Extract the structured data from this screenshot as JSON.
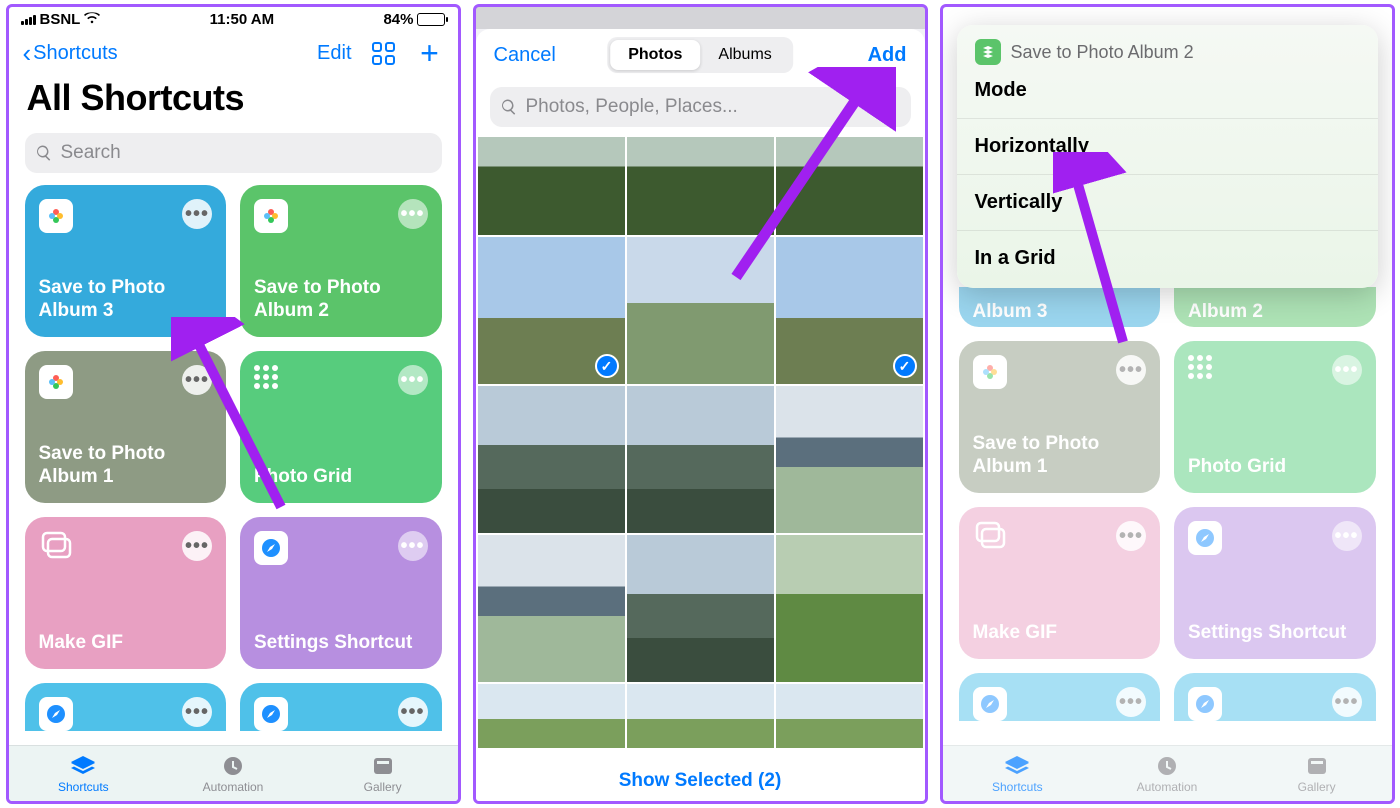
{
  "screen1": {
    "status": {
      "carrier": "BSNL",
      "time": "11:50 AM",
      "battery_pct": "84%"
    },
    "nav": {
      "back": "Shortcuts",
      "edit": "Edit"
    },
    "title": "All Shortcuts",
    "search_placeholder": "Search",
    "tiles": [
      {
        "label": "Save to Photo Album 3",
        "color": "c-blue",
        "icon": "photos"
      },
      {
        "label": "Save to Photo Album 2",
        "color": "c-green",
        "icon": "photos"
      },
      {
        "label": "Save to Photo Album 1",
        "color": "c-olive",
        "icon": "photos"
      },
      {
        "label": "Photo Grid",
        "color": "c-mint",
        "icon": "keypad"
      },
      {
        "label": "Make GIF",
        "color": "c-pink",
        "icon": "stack"
      },
      {
        "label": "Settings Shortcut",
        "color": "c-purple",
        "icon": "safari"
      }
    ],
    "tab_labels": {
      "shortcuts": "Shortcuts",
      "automation": "Automation",
      "gallery": "Gallery"
    }
  },
  "screen2": {
    "cancel": "Cancel",
    "add": "Add",
    "segments": {
      "photos": "Photos",
      "albums": "Albums"
    },
    "search_placeholder": "Photos, People, Places...",
    "footer": "Show Selected (2)"
  },
  "screen3": {
    "popup_title": "Save to Photo Album 2",
    "options": [
      "Mode",
      "Horizontally",
      "Vertically",
      "In a Grid"
    ],
    "bg_tiles": {
      "album3": "Album 3",
      "album2": "Album 2",
      "album1": "Save to Photo Album 1",
      "grid": "Photo Grid",
      "gif": "Make GIF",
      "settings": "Settings Shortcut"
    }
  }
}
